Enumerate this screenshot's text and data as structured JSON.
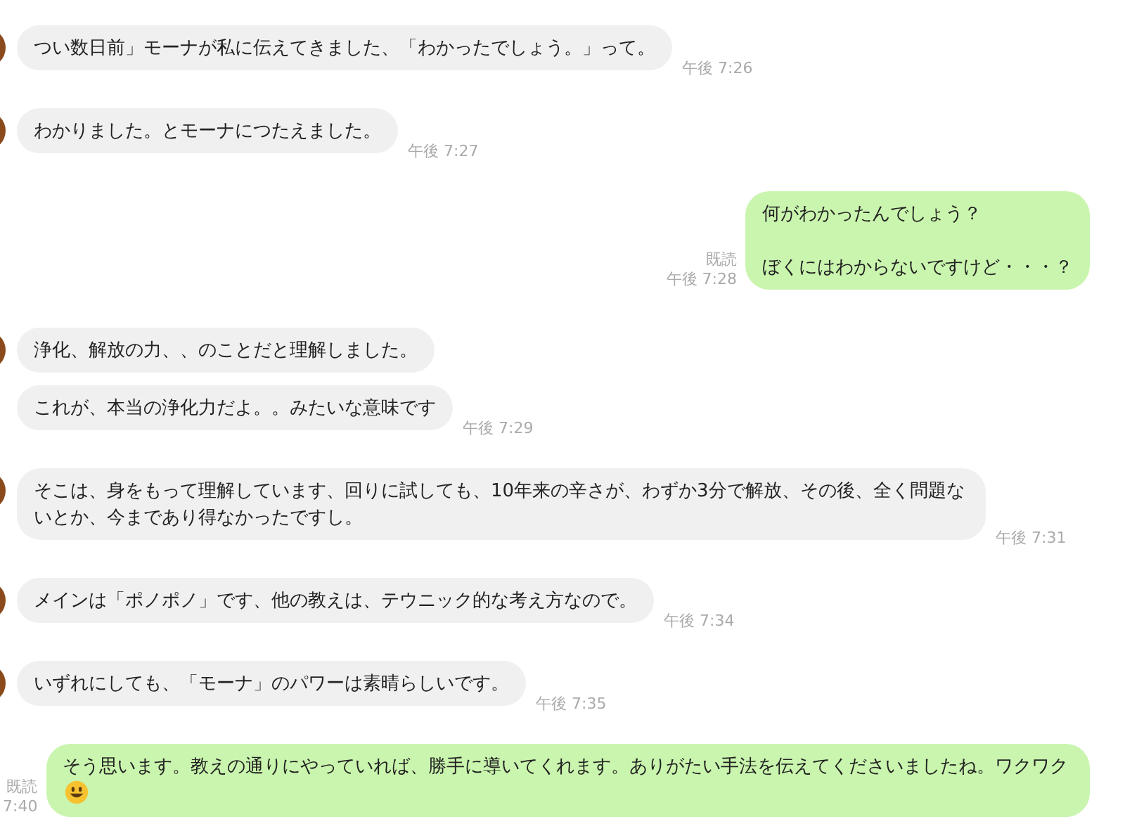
{
  "messages": [
    {
      "kind": "incoming",
      "avatar": true,
      "text": "つい数日前」モーナが私に伝えてきました、「わかったでしょう。」って。",
      "time": "午後 7:26"
    },
    {
      "kind": "incoming",
      "avatar": true,
      "text": "わかりました。とモーナにつたえました。",
      "time": "午後 7:27"
    },
    {
      "kind": "outgoing",
      "paragraphs": [
        "何がわかったんでしょう？",
        "ぼくにはわからないですけど・・・？"
      ],
      "read": "既読",
      "time": "午後 7:28"
    },
    {
      "kind": "incoming",
      "avatar": true,
      "text": "浄化、解放の力、、のことだと理解しました。"
    },
    {
      "kind": "incoming",
      "avatar": false,
      "text": "これが、本当の浄化力だよ。。みたいな意味です",
      "time": "午後 7:29"
    },
    {
      "kind": "incoming",
      "avatar": true,
      "text": "そこは、身をもって理解しています、回りに試しても、10年来の辛さが、わずか3分で解放、その後、全く問題ないとか、今まであり得なかったですし。",
      "time": "午後 7:31"
    },
    {
      "kind": "incoming",
      "avatar": true,
      "text": "メインは「ポノポノ」です、他の教えは、テウニック的な考え方なので。",
      "time": "午後 7:34"
    },
    {
      "kind": "incoming",
      "avatar": true,
      "text": "いずれにしても、「モーナ」のパワーは素晴らしいです。",
      "time": "午後 7:35"
    },
    {
      "kind": "outgoing",
      "text": "そう思います。教えの通りにやっていれば、勝手に導いてくれます。ありがたい手法を伝えてくださいましたね。ワクワク",
      "has_emoji": true,
      "read": "既読",
      "time": "7:40"
    }
  ]
}
